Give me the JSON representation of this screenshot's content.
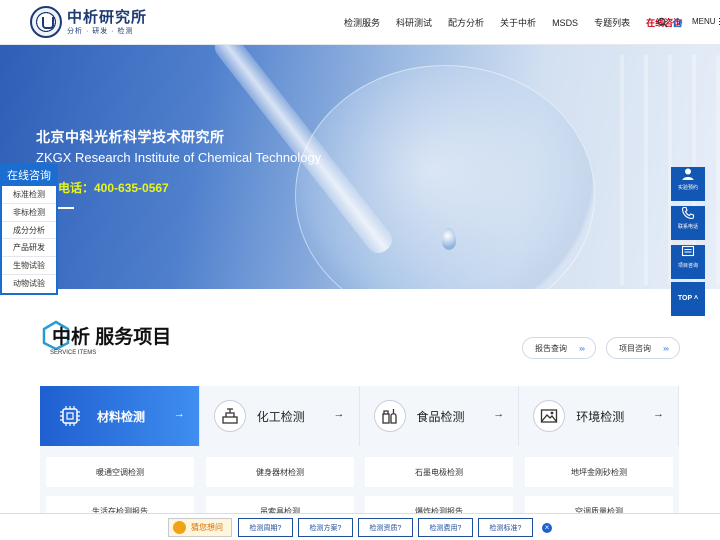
{
  "header": {
    "logo_name": "中析研究所",
    "logo_slogan": "分析 · 研发 · 检测",
    "nav": [
      "检测服务",
      "科研测试",
      "配方分析",
      "关于中析",
      "MSDS",
      "专题列表",
      "在线咨询"
    ],
    "menu_label": "MENU"
  },
  "banner": {
    "title_cn": "北京中科光析科学技术研究所",
    "title_en": "ZKGX Research Institute of Chemical Technology",
    "phone": "电话：400-635-0567"
  },
  "left_float": {
    "title": "在线咨询",
    "items": [
      "标准检测",
      "非标检测",
      "成分分析",
      "产品研发",
      "生物试验",
      "动物试验"
    ]
  },
  "right_float": {
    "items": [
      "实验预约",
      "联系电话",
      "项目咨询"
    ],
    "top_label": "TOP"
  },
  "services": {
    "title_prefix": "中析",
    "title": "服务项目",
    "subtitle": "SERVICE ITEMS",
    "report_query": "报告查询",
    "project_consult": "项目咨询",
    "arrows": "›››",
    "tabs": [
      {
        "label": "材料检测",
        "icon": "chip-icon",
        "arrow": "→"
      },
      {
        "label": "化工检测",
        "icon": "scale-icon",
        "arrow": "→"
      },
      {
        "label": "食品检测",
        "icon": "food-icon",
        "arrow": "→"
      },
      {
        "label": "环境检测",
        "icon": "landscape-icon",
        "arrow": "→"
      }
    ],
    "items": [
      "暖通空调检测",
      "健身器材检测",
      "石墨电极检测",
      "地坪金刚砂检测",
      "生活在检测报告",
      "吊索具检测",
      "爆炸检测报告",
      "空调质量检测"
    ]
  },
  "bottom_bar": {
    "guess_label": "猜您想问",
    "questions": [
      "检测周期?",
      "检测方案?",
      "检测资质?",
      "检测费用?",
      "检测标准?"
    ],
    "close": "×"
  },
  "colors": {
    "brand_navy": "#1e3a72",
    "primary_blue": "#1c6dd0",
    "accent_red": "#d0021b",
    "phone_yellow": "#e8f51c"
  }
}
